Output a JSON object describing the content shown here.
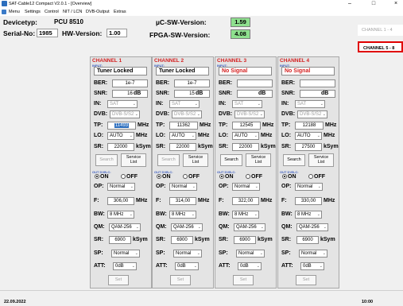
{
  "window": {
    "title": "SAT-Cable12 Compact V2.0.1 - [Overview]",
    "minimize": "–",
    "maximize": "□",
    "close": "×"
  },
  "menu": [
    "Menu",
    "Settings",
    "Control",
    "NIT / LCN",
    "DVB-Output",
    "Extras"
  ],
  "header": {
    "devicetyp_label": "Devicetyp:",
    "devicetyp_value": "PCU 8510",
    "serial_label": "Serial-No:",
    "serial_value": "1985",
    "hw_label": "HW-Version:",
    "hw_value": "1.00",
    "uc_label": "µC-SW-Version:",
    "uc_value": "1.59",
    "fpga_label": "FPGA-SW-Version:",
    "fpga_value": "4.08"
  },
  "side_tabs": [
    "CHANNEL 1 - 4",
    "CHANNEL 5 - 8"
  ],
  "labels": {
    "input_caption": "INPUT:",
    "ber": "BER:",
    "snr": "SNR:",
    "db": "dB",
    "in": "IN:",
    "dvb": "DVB:",
    "tp": "TP:",
    "lo": "LO:",
    "sr": "SR:",
    "mhz": "MHz",
    "ksym": "kSym",
    "search": "Search",
    "service_l1": "Service",
    "service_l2": "List",
    "out_caption": "OUT DVB-C:",
    "on": "ON",
    "off": "OFF",
    "op": "OP:",
    "f": "F:",
    "bw": "BW:",
    "qm": "QM:",
    "sp": "SP:",
    "att": "ATT:",
    "set": "Set"
  },
  "channels": [
    {
      "title": "CHANNEL 1",
      "status": "Tuner Locked",
      "status_color": "#000000",
      "ber": "1e-7",
      "snr": "16",
      "in": "SAT",
      "dvb": "DVB-S/S2",
      "tp": "11493",
      "lo": "AUTO",
      "sr": "22000",
      "out_on": true,
      "op": "Normal",
      "f": "306,00",
      "bw": "8 MHz",
      "qm": "QAM-256",
      "osr": "6900",
      "sp": "Normal",
      "att": "0dB"
    },
    {
      "title": "CHANNEL 2",
      "status": "Tuner Locked",
      "status_color": "#000000",
      "ber": "1e-7",
      "snr": "15",
      "in": "SAT",
      "dvb": "DVB-S/S2",
      "tp": "11362",
      "lo": "AUTO",
      "sr": "22000",
      "out_on": true,
      "op": "Normal",
      "f": "314,00",
      "bw": "8 MHz",
      "qm": "QAM-256",
      "osr": "6900",
      "sp": "Normal",
      "att": "0dB"
    },
    {
      "title": "CHANNEL 3",
      "status": "No Signal",
      "status_color": "#d42020",
      "ber": "",
      "snr": "",
      "in": "SAT",
      "dvb": "DVB-S/S2",
      "tp": "12545",
      "lo": "AUTO",
      "sr": "22000",
      "out_on": true,
      "op": "Normal",
      "f": "322,00",
      "bw": "8 MHz",
      "qm": "QAM-256",
      "osr": "6900",
      "sp": "Normal",
      "att": "0dB"
    },
    {
      "title": "CHANNEL 4",
      "status": "No Signal",
      "status_color": "#d42020",
      "ber": "",
      "snr": "",
      "in": "SAT",
      "dvb": "DVB-S/S2",
      "tp": "12188",
      "lo": "AUTO",
      "sr": "27500",
      "out_on": true,
      "op": "Normal",
      "f": "330,00",
      "bw": "8 MHz",
      "qm": "QAM-256",
      "osr": "6900",
      "sp": "Normal",
      "att": "0dB"
    }
  ],
  "statusbar": {
    "date": "22.09.2022",
    "time": "10:00"
  },
  "colors": {
    "channel_title": "#d42020",
    "version_green": "#8ee08e",
    "active_tab_border": "#e00000"
  }
}
